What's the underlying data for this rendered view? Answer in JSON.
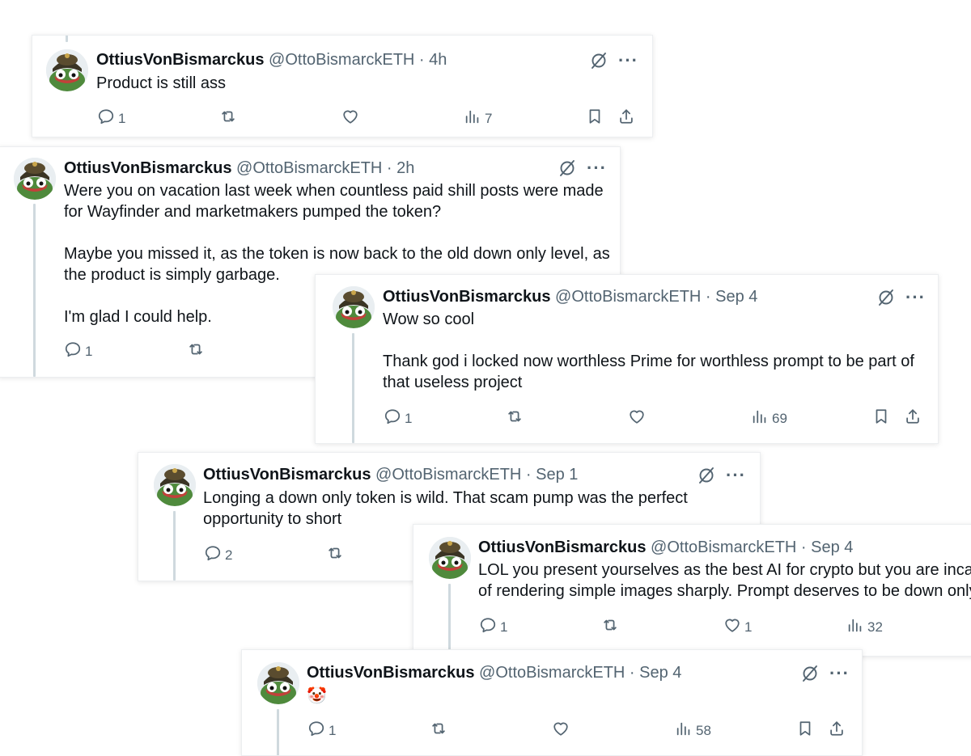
{
  "tweets": [
    {
      "name": "OttiusVonBismarckus",
      "handle": "@OttoBismarckETH",
      "sep": "·",
      "time": "4h",
      "text": "Product is still ass",
      "replies": "1",
      "retweets": "",
      "likes": "",
      "views": "7"
    },
    {
      "name": "OttiusVonBismarckus",
      "handle": "@OttoBismarckETH",
      "sep": "·",
      "time": "2h",
      "text": "Were you on vacation last week when countless paid shill posts were made for Wayfinder and marketmakers pumped the token?\n\nMaybe you missed it, as the token is now back to the old down only level, as the product is simply garbage.\n\nI'm glad I could help.",
      "replies": "1",
      "retweets": "",
      "likes": "",
      "views": ""
    },
    {
      "name": "OttiusVonBismarckus",
      "handle": "@OttoBismarckETH",
      "sep": "·",
      "time": "Sep 4",
      "text": "Wow so cool\n\nThank god i locked now worthless Prime for worthless prompt to be part of that useless project",
      "replies": "1",
      "retweets": "",
      "likes": "",
      "views": "69"
    },
    {
      "name": "OttiusVonBismarckus",
      "handle": "@OttoBismarckETH",
      "sep": "·",
      "time": "Sep 1",
      "text": "Longing a down only token is wild. That scam pump was the perfect opportunity to short",
      "replies": "2",
      "retweets": "",
      "likes": "",
      "views": ""
    },
    {
      "name": "OttiusVonBismarckus",
      "handle": "@OttoBismarckETH",
      "sep": "·",
      "time": "Sep 4",
      "text": "LOL you present yourselves as the best AI for crypto but you are incap\nof rendering simple images sharply. Prompt deserves to be down only",
      "replies": "1",
      "retweets": "",
      "likes": "1",
      "views": "32"
    },
    {
      "name": "OttiusVonBismarckus",
      "handle": "@OttoBismarckETH",
      "sep": "·",
      "time": "Sep 4",
      "text": "🤡",
      "replies": "1",
      "retweets": "",
      "likes": "",
      "views": "58"
    }
  ],
  "icons": {
    "reply": "reply-icon",
    "retweet": "retweet-icon",
    "like": "heart-icon",
    "views": "views-icon",
    "bookmark": "bookmark-icon",
    "share": "share-icon",
    "grok": "grok-icon",
    "more": "more-icon"
  },
  "colors": {
    "text": "#0f1419",
    "secondary": "#536471",
    "thread_line": "#cfd9de",
    "avatar_frog": "#4f8a3c"
  }
}
